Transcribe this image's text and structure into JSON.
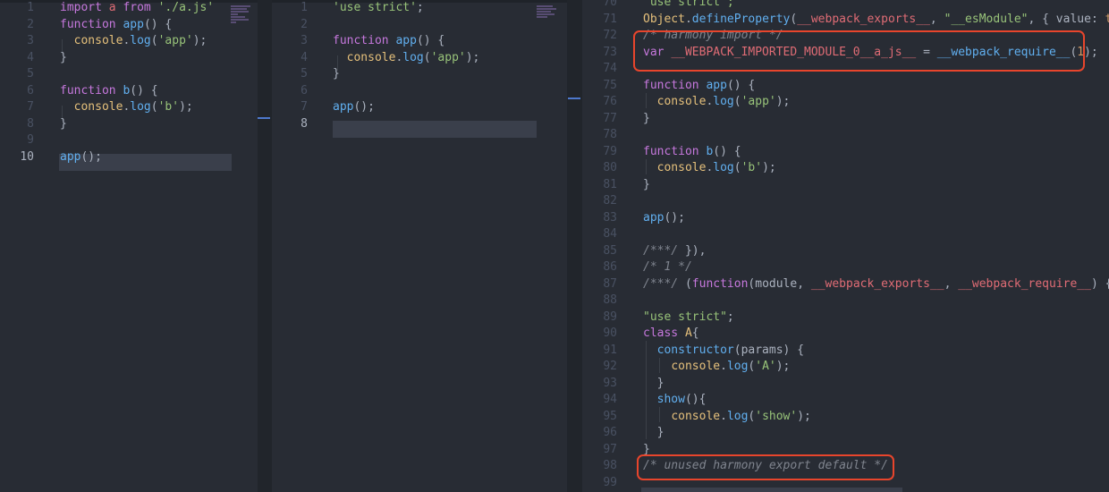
{
  "panes": [
    {
      "name": "source",
      "active_line": 10,
      "lines": [
        {
          "n": "1",
          "t": [
            {
              "k": "kw",
              "v": "import"
            },
            {
              "k": "pl",
              "v": " "
            },
            {
              "k": "id",
              "v": "a"
            },
            {
              "k": "pl",
              "v": " "
            },
            {
              "k": "kw",
              "v": "from"
            },
            {
              "k": "pl",
              "v": " "
            },
            {
              "k": "str",
              "v": "'./a.js'"
            }
          ]
        },
        {
          "n": "2",
          "t": [
            {
              "k": "kw",
              "v": "function"
            },
            {
              "k": "pl",
              "v": " "
            },
            {
              "k": "fn",
              "v": "app"
            },
            {
              "k": "pl",
              "v": "() {"
            }
          ]
        },
        {
          "n": "3",
          "t": [
            {
              "k": "pl",
              "v": "  "
            },
            {
              "k": "obj",
              "v": "console"
            },
            {
              "k": "pl",
              "v": "."
            },
            {
              "k": "fn",
              "v": "log"
            },
            {
              "k": "pl",
              "v": "("
            },
            {
              "k": "str",
              "v": "'app'"
            },
            {
              "k": "pl",
              "v": ");"
            }
          ]
        },
        {
          "n": "4",
          "t": [
            {
              "k": "pl",
              "v": "}"
            }
          ]
        },
        {
          "n": "5",
          "t": []
        },
        {
          "n": "6",
          "t": [
            {
              "k": "kw",
              "v": "function"
            },
            {
              "k": "pl",
              "v": " "
            },
            {
              "k": "fn",
              "v": "b"
            },
            {
              "k": "pl",
              "v": "() {"
            }
          ]
        },
        {
          "n": "7",
          "t": [
            {
              "k": "pl",
              "v": "  "
            },
            {
              "k": "obj",
              "v": "console"
            },
            {
              "k": "pl",
              "v": "."
            },
            {
              "k": "fn",
              "v": "log"
            },
            {
              "k": "pl",
              "v": "("
            },
            {
              "k": "str",
              "v": "'b'"
            },
            {
              "k": "pl",
              "v": ");"
            }
          ]
        },
        {
          "n": "8",
          "t": [
            {
              "k": "pl",
              "v": "}"
            }
          ]
        },
        {
          "n": "9",
          "t": []
        },
        {
          "n": "10",
          "t": [
            {
              "k": "fn",
              "v": "app"
            },
            {
              "k": "pl",
              "v": "();"
            }
          ]
        }
      ]
    },
    {
      "name": "output",
      "active_line": 8,
      "lines": [
        {
          "n": "1",
          "t": [
            {
              "k": "str",
              "v": "'use strict'"
            },
            {
              "k": "pl",
              "v": ";"
            }
          ]
        },
        {
          "n": "2",
          "t": []
        },
        {
          "n": "3",
          "t": [
            {
              "k": "kw",
              "v": "function"
            },
            {
              "k": "pl",
              "v": " "
            },
            {
              "k": "fn",
              "v": "app"
            },
            {
              "k": "pl",
              "v": "() {"
            }
          ]
        },
        {
          "n": "4",
          "t": [
            {
              "k": "pl",
              "v": "  "
            },
            {
              "k": "obj",
              "v": "console"
            },
            {
              "k": "pl",
              "v": "."
            },
            {
              "k": "fn",
              "v": "log"
            },
            {
              "k": "pl",
              "v": "("
            },
            {
              "k": "str",
              "v": "'app'"
            },
            {
              "k": "pl",
              "v": ");"
            }
          ]
        },
        {
          "n": "5",
          "t": [
            {
              "k": "pl",
              "v": "}"
            }
          ]
        },
        {
          "n": "6",
          "t": []
        },
        {
          "n": "7",
          "t": [
            {
              "k": "fn",
              "v": "app"
            },
            {
              "k": "pl",
              "v": "();"
            }
          ]
        },
        {
          "n": "8",
          "t": []
        }
      ]
    },
    {
      "name": "bundle",
      "active_line": null,
      "lines": [
        {
          "n": "70",
          "t": [
            {
              "k": "str",
              "v": "\"use strict\";"
            }
          ]
        },
        {
          "n": "71",
          "t": [
            {
              "k": "obj",
              "v": "Object"
            },
            {
              "k": "pl",
              "v": "."
            },
            {
              "k": "fn",
              "v": "defineProperty"
            },
            {
              "k": "pl",
              "v": "("
            },
            {
              "k": "id",
              "v": "__webpack_exports__"
            },
            {
              "k": "pl",
              "v": ", "
            },
            {
              "k": "str",
              "v": "\"__esModule\""
            },
            {
              "k": "pl",
              "v": ", { value: "
            },
            {
              "k": "num",
              "v": "true"
            }
          ]
        },
        {
          "n": "72",
          "t": [
            {
              "k": "cm",
              "v": "/* harmony import */"
            }
          ]
        },
        {
          "n": "73",
          "t": [
            {
              "k": "kw",
              "v": "var"
            },
            {
              "k": "pl",
              "v": " "
            },
            {
              "k": "id",
              "v": "__WEBPACK_IMPORTED_MODULE_0__a_js__"
            },
            {
              "k": "pl",
              "v": " = "
            },
            {
              "k": "fn",
              "v": "__webpack_require__"
            },
            {
              "k": "pl",
              "v": "("
            },
            {
              "k": "num",
              "v": "1"
            },
            {
              "k": "pl",
              "v": ");"
            }
          ]
        },
        {
          "n": "74",
          "t": []
        },
        {
          "n": "75",
          "t": [
            {
              "k": "kw",
              "v": "function"
            },
            {
              "k": "pl",
              "v": " "
            },
            {
              "k": "fn",
              "v": "app"
            },
            {
              "k": "pl",
              "v": "() {"
            }
          ]
        },
        {
          "n": "76",
          "t": [
            {
              "k": "pl",
              "v": "  "
            },
            {
              "k": "obj",
              "v": "console"
            },
            {
              "k": "pl",
              "v": "."
            },
            {
              "k": "fn",
              "v": "log"
            },
            {
              "k": "pl",
              "v": "("
            },
            {
              "k": "str",
              "v": "'app'"
            },
            {
              "k": "pl",
              "v": ");"
            }
          ]
        },
        {
          "n": "77",
          "t": [
            {
              "k": "pl",
              "v": "}"
            }
          ]
        },
        {
          "n": "78",
          "t": []
        },
        {
          "n": "79",
          "t": [
            {
              "k": "kw",
              "v": "function"
            },
            {
              "k": "pl",
              "v": " "
            },
            {
              "k": "fn",
              "v": "b"
            },
            {
              "k": "pl",
              "v": "() {"
            }
          ]
        },
        {
          "n": "80",
          "t": [
            {
              "k": "pl",
              "v": "  "
            },
            {
              "k": "obj",
              "v": "console"
            },
            {
              "k": "pl",
              "v": "."
            },
            {
              "k": "fn",
              "v": "log"
            },
            {
              "k": "pl",
              "v": "("
            },
            {
              "k": "str",
              "v": "'b'"
            },
            {
              "k": "pl",
              "v": ");"
            }
          ]
        },
        {
          "n": "81",
          "t": [
            {
              "k": "pl",
              "v": "}"
            }
          ]
        },
        {
          "n": "82",
          "t": []
        },
        {
          "n": "83",
          "t": [
            {
              "k": "fn",
              "v": "app"
            },
            {
              "k": "pl",
              "v": "();"
            }
          ]
        },
        {
          "n": "84",
          "t": []
        },
        {
          "n": "85",
          "t": [
            {
              "k": "cm",
              "v": "/***/"
            },
            {
              "k": "pl",
              "v": " }),"
            }
          ]
        },
        {
          "n": "86",
          "t": [
            {
              "k": "cm",
              "v": "/* 1 */"
            }
          ]
        },
        {
          "n": "87",
          "t": [
            {
              "k": "cm",
              "v": "/***/"
            },
            {
              "k": "pl",
              "v": " ("
            },
            {
              "k": "kw",
              "v": "function"
            },
            {
              "k": "pl",
              "v": "(module, "
            },
            {
              "k": "id",
              "v": "__webpack_exports__"
            },
            {
              "k": "pl",
              "v": ", "
            },
            {
              "k": "id",
              "v": "__webpack_require__"
            },
            {
              "k": "pl",
              "v": ") {"
            }
          ]
        },
        {
          "n": "88",
          "t": []
        },
        {
          "n": "89",
          "t": [
            {
              "k": "str",
              "v": "\"use strict\""
            },
            {
              "k": "pl",
              "v": ";"
            }
          ]
        },
        {
          "n": "90",
          "t": [
            {
              "k": "kw",
              "v": "class"
            },
            {
              "k": "pl",
              "v": " "
            },
            {
              "k": "obj",
              "v": "A"
            },
            {
              "k": "pl",
              "v": "{"
            }
          ]
        },
        {
          "n": "91",
          "t": [
            {
              "k": "pl",
              "v": "  "
            },
            {
              "k": "fn",
              "v": "constructor"
            },
            {
              "k": "pl",
              "v": "(params) {"
            }
          ]
        },
        {
          "n": "92",
          "t": [
            {
              "k": "pl",
              "v": "    "
            },
            {
              "k": "obj",
              "v": "console"
            },
            {
              "k": "pl",
              "v": "."
            },
            {
              "k": "fn",
              "v": "log"
            },
            {
              "k": "pl",
              "v": "("
            },
            {
              "k": "str",
              "v": "'A'"
            },
            {
              "k": "pl",
              "v": ");"
            }
          ]
        },
        {
          "n": "93",
          "t": [
            {
              "k": "pl",
              "v": "  }"
            }
          ]
        },
        {
          "n": "94",
          "t": [
            {
              "k": "pl",
              "v": "  "
            },
            {
              "k": "fn",
              "v": "show"
            },
            {
              "k": "pl",
              "v": "(){"
            }
          ]
        },
        {
          "n": "95",
          "t": [
            {
              "k": "pl",
              "v": "    "
            },
            {
              "k": "obj",
              "v": "console"
            },
            {
              "k": "pl",
              "v": "."
            },
            {
              "k": "fn",
              "v": "log"
            },
            {
              "k": "pl",
              "v": "("
            },
            {
              "k": "str",
              "v": "'show'"
            },
            {
              "k": "pl",
              "v": ");"
            }
          ]
        },
        {
          "n": "96",
          "t": [
            {
              "k": "pl",
              "v": "  }"
            }
          ]
        },
        {
          "n": "97",
          "t": [
            {
              "k": "pl",
              "v": "}"
            }
          ]
        },
        {
          "n": "98",
          "t": [
            {
              "k": "cm",
              "v": "/* unused harmony export default */"
            }
          ]
        },
        {
          "n": "99",
          "t": []
        }
      ]
    }
  ],
  "colors": {
    "background": "#282c34",
    "annotation_box": "#e8452c",
    "keyword": "#c678dd",
    "function": "#61afef",
    "string": "#98c379",
    "identifier": "#e06c75",
    "number": "#d19a66",
    "object": "#e5c07b",
    "comment": "#7f848e"
  }
}
